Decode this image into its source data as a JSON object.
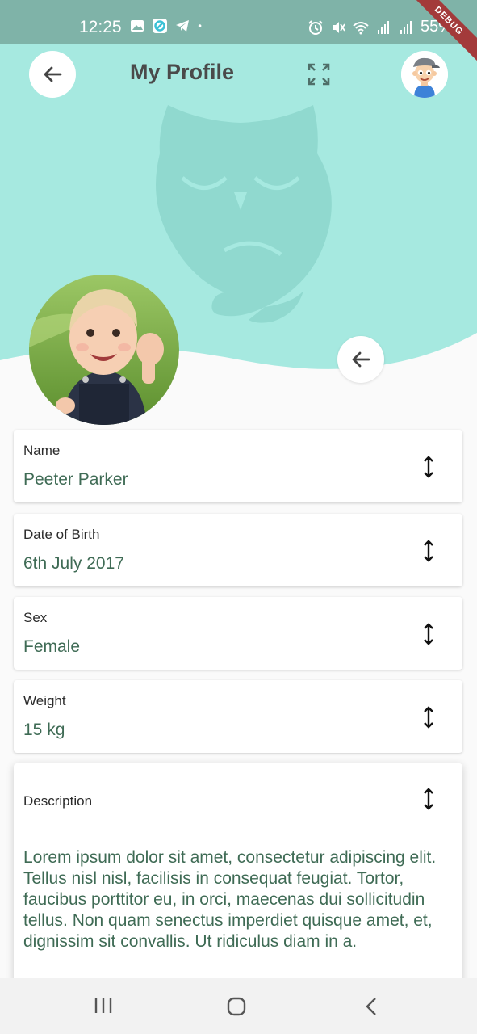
{
  "status_bar": {
    "time": "12:25",
    "battery": "55%",
    "debug_label": "DEBUG"
  },
  "header": {
    "title": "My Profile"
  },
  "colors": {
    "teal": "#a6e9e0",
    "owl": "#90d9cf",
    "status_bar": "#7fb3a8",
    "value_text": "#3f6b55"
  },
  "fields": [
    {
      "label": "Name",
      "value": "Peeter Parker"
    },
    {
      "label": "Date of Birth",
      "value": "6th July 2017"
    },
    {
      "label": "Sex",
      "value": "Female"
    },
    {
      "label": "Weight",
      "value": "15 kg"
    }
  ],
  "description": {
    "label": "Description",
    "text": "Lorem ipsum dolor sit amet, consectetur adipiscing elit. Tellus nisl nisl, facilisis in consequat feugiat. Tortor, faucibus porttitor eu, in orci, maecenas dui sollicitudin tellus. Non quam senectus imperdiet quisque amet, et, dignissim sit convallis. Ut ridiculus diam in a."
  },
  "icons": {
    "back": "arrow-left-icon",
    "expand": "expand-icon",
    "resize": "resize-vertical-icon",
    "avatar": "cartoon-boy-avatar",
    "nav_recent": "recent-apps-icon",
    "nav_home": "home-icon",
    "nav_back": "chevron-left-icon"
  }
}
